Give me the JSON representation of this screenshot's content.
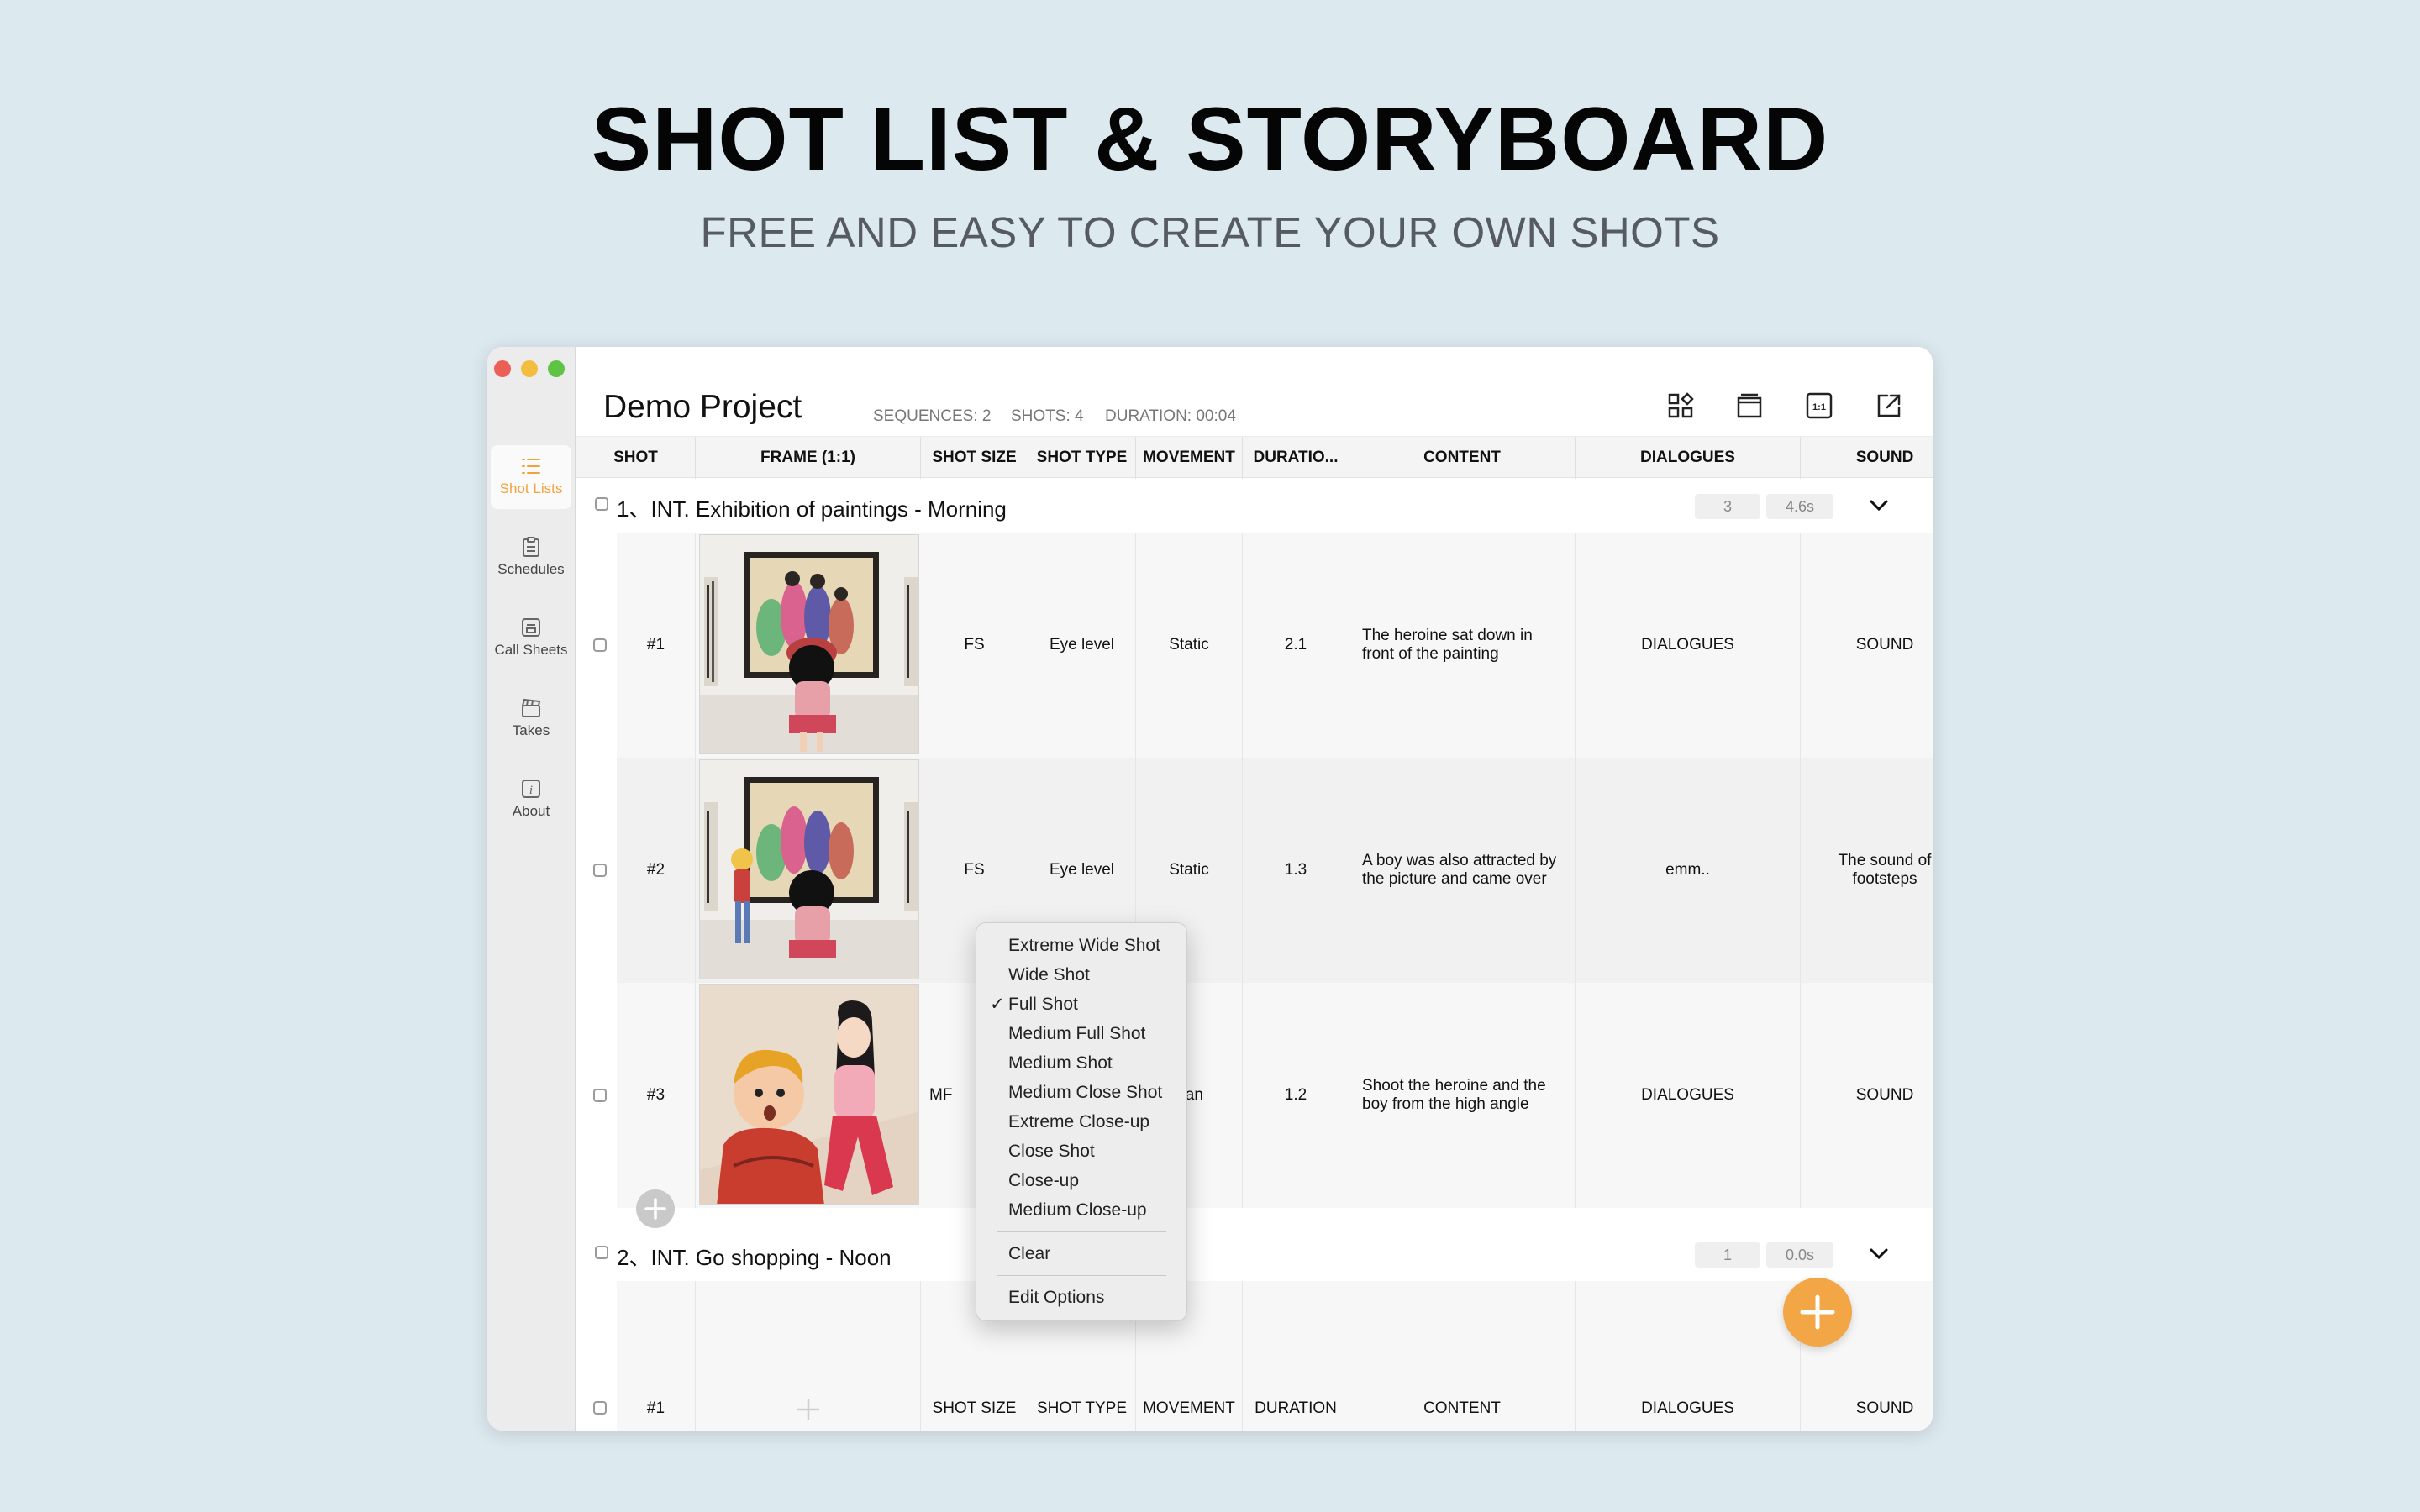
{
  "hero": {
    "title": "SHOT LIST & STORYBOARD",
    "subtitle": "FREE AND EASY TO CREATE YOUR OWN SHOTS"
  },
  "sidebar": {
    "items": [
      {
        "label": "Shot Lists",
        "icon": "list-icon"
      },
      {
        "label": "Schedules",
        "icon": "clipboard-icon"
      },
      {
        "label": "Call Sheets",
        "icon": "sheet-icon"
      },
      {
        "label": "Takes",
        "icon": "clapper-icon"
      },
      {
        "label": "About",
        "icon": "info-icon"
      }
    ]
  },
  "project": {
    "name": "Demo Project",
    "sequences": "SEQUENCES: 2",
    "shots": "SHOTS: 4",
    "duration": "DURATION: 00:04"
  },
  "columns": [
    "SHOT",
    "FRAME (1:1)",
    "SHOT SIZE",
    "SHOT TYPE",
    "MOVEMENT",
    "DURATIO...",
    "CONTENT",
    "DIALOGUES",
    "SOUND"
  ],
  "sequences": [
    {
      "title": "1、INT. Exhibition of paintings - Morning",
      "count": "3",
      "duration": "4.6s",
      "shots": [
        {
          "shot": "#1",
          "size": "FS",
          "type": "Eye level",
          "movement": "Static",
          "duration": "2.1",
          "content": "The heroine sat down in front of the painting",
          "dialogues": "DIALOGUES",
          "sound": "SOUND"
        },
        {
          "shot": "#2",
          "size": "FS",
          "type": "Eye level",
          "movement": "Static",
          "duration": "1.3",
          "content": "A boy was also attracted by the picture and came over",
          "dialogues": "emm..",
          "sound": "The sound of footsteps"
        },
        {
          "shot": "#3",
          "size": "MF",
          "type": "",
          "movement": "Pan",
          "duration": "1.2",
          "content": "Shoot the heroine and the boy from the high angle",
          "dialogues": "DIALOGUES",
          "sound": "SOUND"
        }
      ]
    },
    {
      "title": "2、INT. Go shopping - Noon",
      "count": "1",
      "duration": "0.0s",
      "shots": [
        {
          "shot": "#1",
          "size": "SHOT SIZE",
          "type": "SHOT TYPE",
          "movement": "MOVEMENT",
          "duration": "DURATION",
          "content": "CONTENT",
          "dialogues": "DIALOGUES",
          "sound": "SOUND"
        }
      ]
    }
  ],
  "menu": {
    "items": [
      "Extreme Wide Shot",
      "Wide Shot",
      "Full Shot",
      "Medium Full Shot",
      "Medium Shot",
      "Medium Close Shot",
      "Extreme Close-up",
      "Close Shot",
      "Close-up",
      "Medium Close-up"
    ],
    "checked": "Full Shot",
    "checkmark": "✓",
    "clear": "Clear",
    "edit": "Edit Options"
  },
  "colors": {
    "accent": "#f3a645",
    "background": "#dce9ef"
  }
}
